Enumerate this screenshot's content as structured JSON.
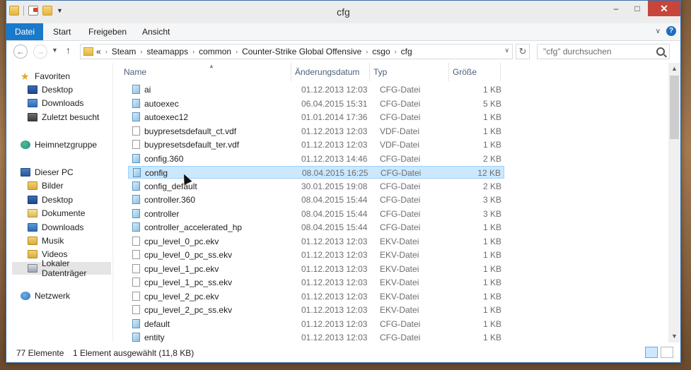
{
  "window": {
    "title": "cfg"
  },
  "window_buttons": {
    "minimize": "–",
    "maximize": "□",
    "close": "✕"
  },
  "ribbon": {
    "tabs": [
      "Datei",
      "Start",
      "Freigeben",
      "Ansicht"
    ],
    "help": "?"
  },
  "address": {
    "breadcrumb": [
      "Steam",
      "steamapps",
      "common",
      "Counter-Strike Global Offensive",
      "csgo",
      "cfg"
    ],
    "overflow": "«"
  },
  "search": {
    "placeholder": "\"cfg\" durchsuchen"
  },
  "nav_pane": {
    "favorites": {
      "label": "Favoriten",
      "items": [
        "Desktop",
        "Downloads",
        "Zuletzt besucht"
      ]
    },
    "homegroup": "Heimnetzgruppe",
    "this_pc": {
      "label": "Dieser PC",
      "items": [
        "Bilder",
        "Desktop",
        "Dokumente",
        "Downloads",
        "Musik",
        "Videos",
        "Lokaler Datenträger"
      ]
    },
    "network": "Netzwerk"
  },
  "columns": {
    "name": "Name",
    "date": "Änderungsdatum",
    "type": "Typ",
    "size": "Größe"
  },
  "files": [
    {
      "name": "ai",
      "date": "01.12.2013 12:03",
      "type": "CFG-Datei",
      "size": "1 KB",
      "icon": "cfg"
    },
    {
      "name": "autoexec",
      "date": "06.04.2015 15:31",
      "type": "CFG-Datei",
      "size": "5 KB",
      "icon": "cfg"
    },
    {
      "name": "autoexec12",
      "date": "01.01.2014 17:36",
      "type": "CFG-Datei",
      "size": "1 KB",
      "icon": "cfg"
    },
    {
      "name": "buypresetsdefault_ct.vdf",
      "date": "01.12.2013 12:03",
      "type": "VDF-Datei",
      "size": "1 KB",
      "icon": "plain"
    },
    {
      "name": "buypresetsdefault_ter.vdf",
      "date": "01.12.2013 12:03",
      "type": "VDF-Datei",
      "size": "1 KB",
      "icon": "plain"
    },
    {
      "name": "config.360",
      "date": "01.12.2013 14:46",
      "type": "CFG-Datei",
      "size": "2 KB",
      "icon": "cfg"
    },
    {
      "name": "config",
      "date": "08.04.2015 16:25",
      "type": "CFG-Datei",
      "size": "12 KB",
      "icon": "cfg",
      "selected": true
    },
    {
      "name": "config_default",
      "date": "30.01.2015 19:08",
      "type": "CFG-Datei",
      "size": "2 KB",
      "icon": "cfg"
    },
    {
      "name": "controller.360",
      "date": "08.04.2015 15:44",
      "type": "CFG-Datei",
      "size": "3 KB",
      "icon": "cfg"
    },
    {
      "name": "controller",
      "date": "08.04.2015 15:44",
      "type": "CFG-Datei",
      "size": "3 KB",
      "icon": "cfg"
    },
    {
      "name": "controller_accelerated_hp",
      "date": "08.04.2015 15:44",
      "type": "CFG-Datei",
      "size": "1 KB",
      "icon": "cfg"
    },
    {
      "name": "cpu_level_0_pc.ekv",
      "date": "01.12.2013 12:03",
      "type": "EKV-Datei",
      "size": "1 KB",
      "icon": "plain"
    },
    {
      "name": "cpu_level_0_pc_ss.ekv",
      "date": "01.12.2013 12:03",
      "type": "EKV-Datei",
      "size": "1 KB",
      "icon": "plain"
    },
    {
      "name": "cpu_level_1_pc.ekv",
      "date": "01.12.2013 12:03",
      "type": "EKV-Datei",
      "size": "1 KB",
      "icon": "plain"
    },
    {
      "name": "cpu_level_1_pc_ss.ekv",
      "date": "01.12.2013 12:03",
      "type": "EKV-Datei",
      "size": "1 KB",
      "icon": "plain"
    },
    {
      "name": "cpu_level_2_pc.ekv",
      "date": "01.12.2013 12:03",
      "type": "EKV-Datei",
      "size": "1 KB",
      "icon": "plain"
    },
    {
      "name": "cpu_level_2_pc_ss.ekv",
      "date": "01.12.2013 12:03",
      "type": "EKV-Datei",
      "size": "1 KB",
      "icon": "plain"
    },
    {
      "name": "default",
      "date": "01.12.2013 12:03",
      "type": "CFG-Datei",
      "size": "1 KB",
      "icon": "cfg"
    },
    {
      "name": "entity",
      "date": "01.12.2013 12:03",
      "type": "CFG-Datei",
      "size": "1 KB",
      "icon": "cfg"
    }
  ],
  "status": {
    "count": "77 Elemente",
    "selection": "1 Element ausgewählt (11,8 KB)"
  },
  "colors": {
    "file_tab": "#1979ca",
    "selection_bg": "#cce8ff",
    "selection_border": "#99d1ff",
    "close_button": "#c7453a"
  }
}
